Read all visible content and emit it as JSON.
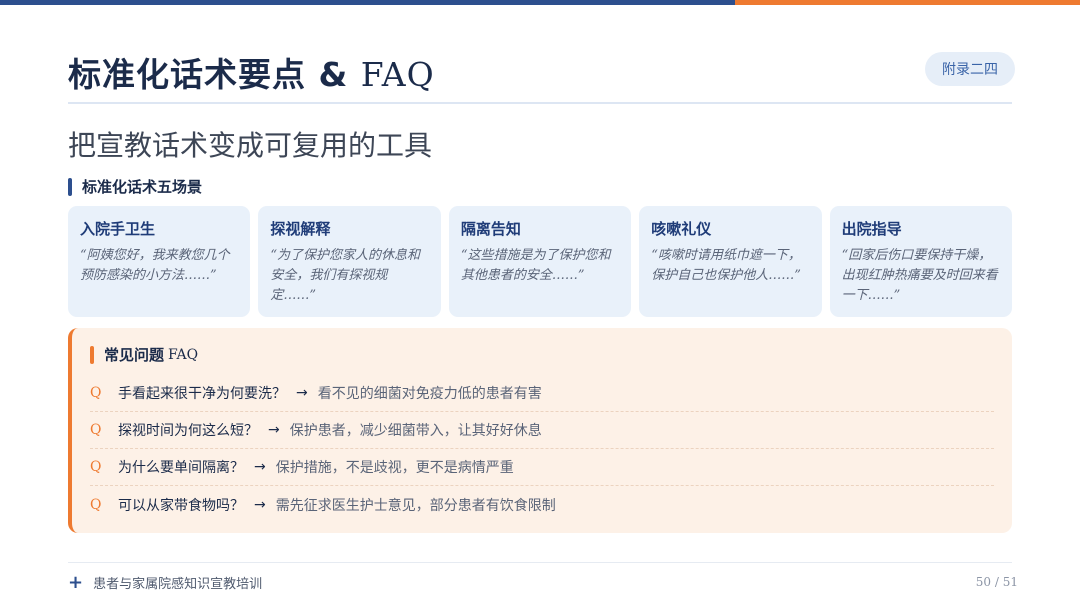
{
  "header": {
    "title_main": "标准化话术要点 ",
    "title_amp": "& ",
    "title_faq": "FAQ",
    "badge": "附录二四"
  },
  "subtitle": "把宣教话术变成可复用的工具",
  "scenes": {
    "heading": "标准化话术五场景",
    "cards": [
      {
        "title": "入院手卫生",
        "quote": "“阿姨您好，我来教您几个预防感染的小方法……”"
      },
      {
        "title": "探视解释",
        "quote": "“为了保护您家人的休息和安全，我们有探视规定……”"
      },
      {
        "title": "隔离告知",
        "quote": "“这些措施是为了保护您和其他患者的安全……”"
      },
      {
        "title": "咳嗽礼仪",
        "quote": "“咳嗽时请用纸巾遮一下，保护自己也保护他人……”"
      },
      {
        "title": "出院指导",
        "quote": "“回家后伤口要保持干燥，出现红肿热痛要及时回来看一下……”"
      }
    ]
  },
  "faq": {
    "heading": "常见问题",
    "heading_suffix": "FAQ",
    "q_marker": "Q",
    "arrow": "→",
    "items": [
      {
        "question": "手看起来很干净为何要洗？",
        "answer": "看不见的细菌对免疫力低的患者有害"
      },
      {
        "question": "探视时间为何这么短？",
        "answer": "保护患者，减少细菌带入，让其好好休息"
      },
      {
        "question": "为什么要单间隔离？",
        "answer": "保护措施，不是歧视，更不是病情严重"
      },
      {
        "question": "可以从家带食物吗？",
        "answer": "需先征求医生护士意见，部分患者有饮食限制"
      }
    ]
  },
  "footer": {
    "plus_icon": "+",
    "text": "患者与家属院感知识宣教培训",
    "page": "50 / 51"
  },
  "colors": {
    "primary": "#2d4f8e",
    "accent": "#ee7a30",
    "card_bg": "#e9f1fa",
    "faq_bg": "#fdf1e7"
  }
}
